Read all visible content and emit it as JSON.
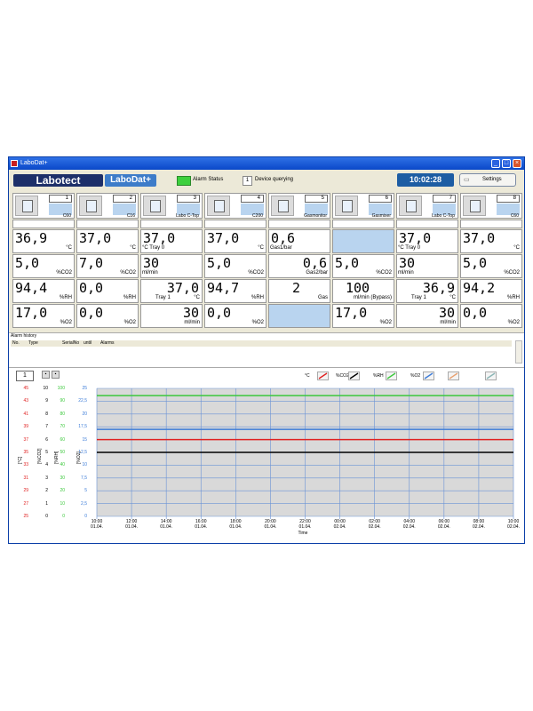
{
  "window": {
    "title": "LaboDat+"
  },
  "toolbar": {
    "logo_labotect": "Labotect",
    "logo_labodat": "LaboDat+",
    "alarm_status_label": "Alarm Status",
    "query_device_number": "1",
    "query_label": "Device querying",
    "clock": "10:02:28",
    "settings_label": "Settings"
  },
  "devices": [
    {
      "number": "1",
      "name": "C60",
      "rows": [
        {
          "value": "36,9",
          "unit": "°C",
          "sub": ""
        },
        {
          "value": "5,0",
          "unit": "%CO2",
          "sub": ""
        },
        {
          "value": "94,4",
          "unit": "%RH",
          "sub": ""
        },
        {
          "value": "17,0",
          "unit": "%O2",
          "sub": ""
        }
      ]
    },
    {
      "number": "2",
      "name": "C16",
      "rows": [
        {
          "value": "37,0",
          "unit": "°C",
          "sub": ""
        },
        {
          "value": "7,0",
          "unit": "%CO2",
          "sub": ""
        },
        {
          "value": "0,0",
          "unit": "%RH",
          "sub": ""
        },
        {
          "value": "0,0",
          "unit": "%O2",
          "sub": ""
        }
      ]
    },
    {
      "number": "3",
      "name": "Labo C-Top",
      "rows": [
        {
          "value": "37,0",
          "unit": "",
          "sub": "°C   Tray 0"
        },
        {
          "value": "30",
          "unit": "",
          "sub": "ml/min"
        },
        {
          "value": "37,0",
          "unit": "°C",
          "sub": "Tray 1"
        },
        {
          "value": "30",
          "unit": "ml/min",
          "sub": ""
        }
      ]
    },
    {
      "number": "4",
      "name": "C200",
      "rows": [
        {
          "value": "37,0",
          "unit": "°C",
          "sub": ""
        },
        {
          "value": "5,0",
          "unit": "%CO2",
          "sub": ""
        },
        {
          "value": "94,7",
          "unit": "%RH",
          "sub": ""
        },
        {
          "value": "0,0",
          "unit": "%O2",
          "sub": ""
        }
      ]
    },
    {
      "number": "5",
      "name": "Gasmonitor",
      "rows": [
        {
          "value": "0,6",
          "unit": "",
          "sub": "Gas1/bar"
        },
        {
          "value": "0,6",
          "unit": "Gas2/bar",
          "sub": ""
        },
        {
          "value": "2",
          "unit": "Gas",
          "sub": ""
        },
        {
          "value": "",
          "unit": "",
          "sub": ""
        }
      ]
    },
    {
      "number": "6",
      "name": "Gasmixer",
      "rows": [
        {
          "value": "",
          "unit": "",
          "sub": ""
        },
        {
          "value": "5,0",
          "unit": "%CO2",
          "sub": ""
        },
        {
          "value": "100",
          "unit": "ml/min (Bypass)",
          "sub": ""
        },
        {
          "value": "17,0",
          "unit": "%O2",
          "sub": ""
        }
      ]
    },
    {
      "number": "7",
      "name": "Labo C-Top",
      "rows": [
        {
          "value": "37,0",
          "unit": "",
          "sub": "°C   Tray 0"
        },
        {
          "value": "30",
          "unit": "",
          "sub": "ml/min"
        },
        {
          "value": "36,9",
          "unit": "°C",
          "sub": "Tray 1"
        },
        {
          "value": "30",
          "unit": "ml/min",
          "sub": ""
        }
      ]
    },
    {
      "number": "8",
      "name": "C60",
      "rows": [
        {
          "value": "37,0",
          "unit": "°C",
          "sub": ""
        },
        {
          "value": "5,0",
          "unit": "%CO2",
          "sub": ""
        },
        {
          "value": "94,2",
          "unit": "%RH",
          "sub": ""
        },
        {
          "value": "0,0",
          "unit": "%O2",
          "sub": ""
        }
      ]
    }
  ],
  "alarm_history": {
    "title": "Alarm history",
    "columns": [
      "No.",
      "Type",
      "SerialNo",
      "until",
      "Alarms"
    ]
  },
  "chart_panel": {
    "device_number": "1",
    "legend": [
      {
        "label": "°C",
        "color": "#e02020"
      },
      {
        "label": "%CO2",
        "color": "#000000"
      },
      {
        "label": "%RH",
        "color": "#3cc83c"
      },
      {
        "label": "%O2",
        "color": "#3c7cd8"
      },
      {
        "label": "",
        "color": "#e8a070"
      },
      {
        "label": "",
        "color": "#8ab4b4"
      }
    ]
  },
  "chart_data": {
    "type": "line",
    "xlabel": "Time",
    "x_ticks": [
      "10:00\n01.04.",
      "12:00\n01.04.",
      "14:00\n01.04.",
      "16:00\n01.04.",
      "18:00\n01.04.",
      "20:00\n01.04.",
      "22:00\n01.04.",
      "00:00\n02.04.",
      "02:00\n02.04.",
      "04:00\n02.04.",
      "06:00\n02.04.",
      "08:00\n02.04.",
      "10:00\n02.04."
    ],
    "axes": [
      {
        "name": "[°C]",
        "color": "#e02020",
        "ticks": [
          "45",
          "43",
          "41",
          "39",
          "37",
          "35",
          "33",
          "31",
          "29",
          "27",
          "25"
        ],
        "ylim": [
          25,
          45
        ]
      },
      {
        "name": "[%CO2]",
        "color": "#000000",
        "ticks": [
          "10",
          "9",
          "8",
          "7",
          "6",
          "5",
          "4",
          "3",
          "2",
          "1",
          "0"
        ],
        "ylim": [
          0,
          10
        ]
      },
      {
        "name": "[%RH]",
        "color": "#3cc83c",
        "ticks": [
          "100",
          "90",
          "80",
          "70",
          "60",
          "50",
          "40",
          "30",
          "20",
          "10",
          "0"
        ],
        "ylim": [
          0,
          100
        ]
      },
      {
        "name": "[%O2]",
        "color": "#3c7cd8",
        "ticks": [
          "25",
          "22,5",
          "20",
          "17,5",
          "15",
          "12,5",
          "10",
          "7,5",
          "5",
          "2,5",
          "0"
        ],
        "ylim": [
          0,
          25
        ]
      }
    ],
    "series": [
      {
        "name": "°C",
        "axis": 0,
        "color": "#e02020",
        "values": [
          37.0,
          37.0
        ]
      },
      {
        "name": "%CO2",
        "axis": 1,
        "color": "#000000",
        "values": [
          5.0,
          5.0
        ]
      },
      {
        "name": "%RH",
        "axis": 2,
        "color": "#3cc83c",
        "values": [
          94.4,
          94.4
        ]
      },
      {
        "name": "%O2",
        "axis": 3,
        "color": "#3c7cd8",
        "values": [
          17.0,
          17.0
        ]
      }
    ]
  }
}
